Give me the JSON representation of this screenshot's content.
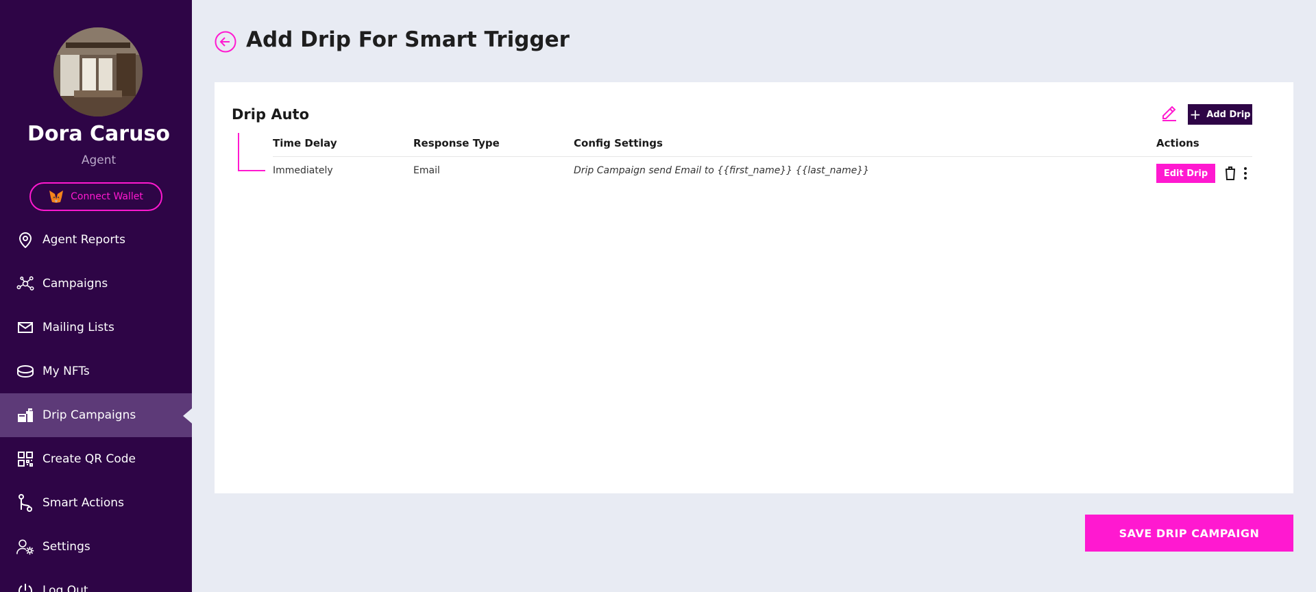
{
  "user": {
    "name": "Dora Caruso",
    "role": "Agent"
  },
  "wallet": {
    "label": "Connect Wallet"
  },
  "sidebar": {
    "items": [
      {
        "label": "Agent Reports",
        "icon": "map-pin-icon"
      },
      {
        "label": "Campaigns",
        "icon": "network-icon"
      },
      {
        "label": "Mailing Lists",
        "icon": "mail-icon"
      },
      {
        "label": "My NFTs",
        "icon": "coins-icon"
      },
      {
        "label": "Drip Campaigns",
        "icon": "drip-mailbox-icon",
        "active": true
      },
      {
        "label": "Create QR Code",
        "icon": "qr-code-icon"
      },
      {
        "label": "Smart Actions",
        "icon": "git-branch-icon"
      },
      {
        "label": "Settings",
        "icon": "user-settings-icon"
      },
      {
        "label": "Log Out",
        "icon": "power-icon"
      }
    ]
  },
  "header": {
    "title": "Add Drip For Smart Trigger"
  },
  "card": {
    "title": "Drip Auto",
    "add_drip_label": "Add Drip",
    "columns": [
      "Time Delay",
      "Response Type",
      "Config Settings",
      "Actions"
    ],
    "rows": [
      {
        "time_delay": "Immediately",
        "response_type": "Email",
        "config": "Drip Campaign send Email to {{first_name}} {{last_name}}",
        "edit_label": "Edit Drip"
      }
    ]
  },
  "footer": {
    "save_label": "SAVE DRIP CAMPAIGN"
  },
  "colors": {
    "sidebar_bg": "#2e0546",
    "active_item_bg": "#5d3a78",
    "accent": "#ff19d0",
    "page_bg": "#e8ebf3"
  }
}
